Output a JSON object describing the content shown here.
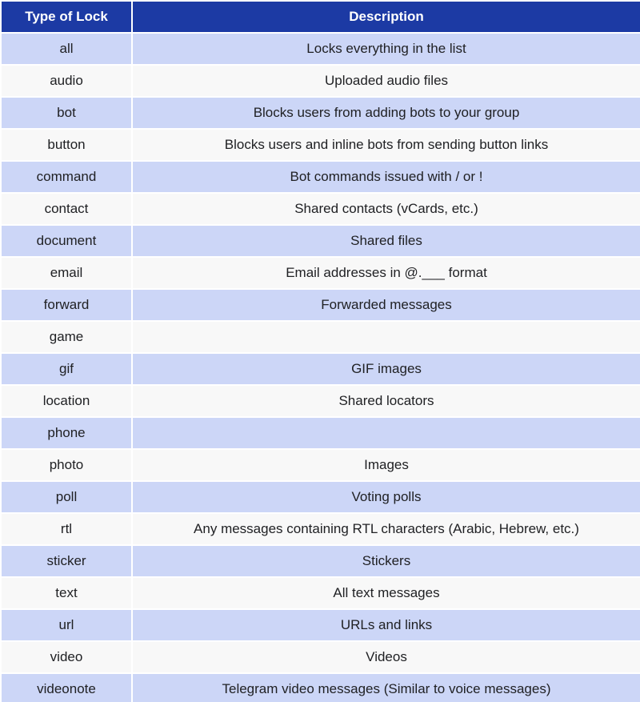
{
  "table": {
    "columns": [
      {
        "key": "type",
        "label": "Type of Lock"
      },
      {
        "key": "description",
        "label": "Description"
      }
    ],
    "header_bg": "#1c3aa4",
    "header_fg": "#ffffff",
    "row_odd_bg": "#ccd6f7",
    "row_even_bg": "#f8f8f8",
    "text_color": "#202124",
    "rows": [
      {
        "type": "all",
        "description": "Locks everything in the list"
      },
      {
        "type": "audio",
        "description": "Uploaded audio files"
      },
      {
        "type": "bot",
        "description": "Blocks users from adding bots to your group"
      },
      {
        "type": "button",
        "description": "Blocks users and inline bots from sending button links"
      },
      {
        "type": "command",
        "description": "Bot commands issued with / or !"
      },
      {
        "type": "contact",
        "description": "Shared contacts (vCards, etc.)"
      },
      {
        "type": "document",
        "description": "Shared files"
      },
      {
        "type": "email",
        "description": "Email addresses in @.___ format"
      },
      {
        "type": "forward",
        "description": "Forwarded messages"
      },
      {
        "type": "game",
        "description": ""
      },
      {
        "type": "gif",
        "description": "GIF images"
      },
      {
        "type": "location",
        "description": "Shared locators"
      },
      {
        "type": "phone",
        "description": ""
      },
      {
        "type": "photo",
        "description": "Images"
      },
      {
        "type": "poll",
        "description": "Voting polls"
      },
      {
        "type": "rtl",
        "description": "Any messages containing RTL characters (Arabic, Hebrew, etc.)"
      },
      {
        "type": "sticker",
        "description": "Stickers"
      },
      {
        "type": "text",
        "description": "All text messages"
      },
      {
        "type": "url",
        "description": "URLs and links"
      },
      {
        "type": "video",
        "description": "Videos"
      },
      {
        "type": "videonote",
        "description": "Telegram video messages (Similar to voice messages)"
      }
    ]
  }
}
